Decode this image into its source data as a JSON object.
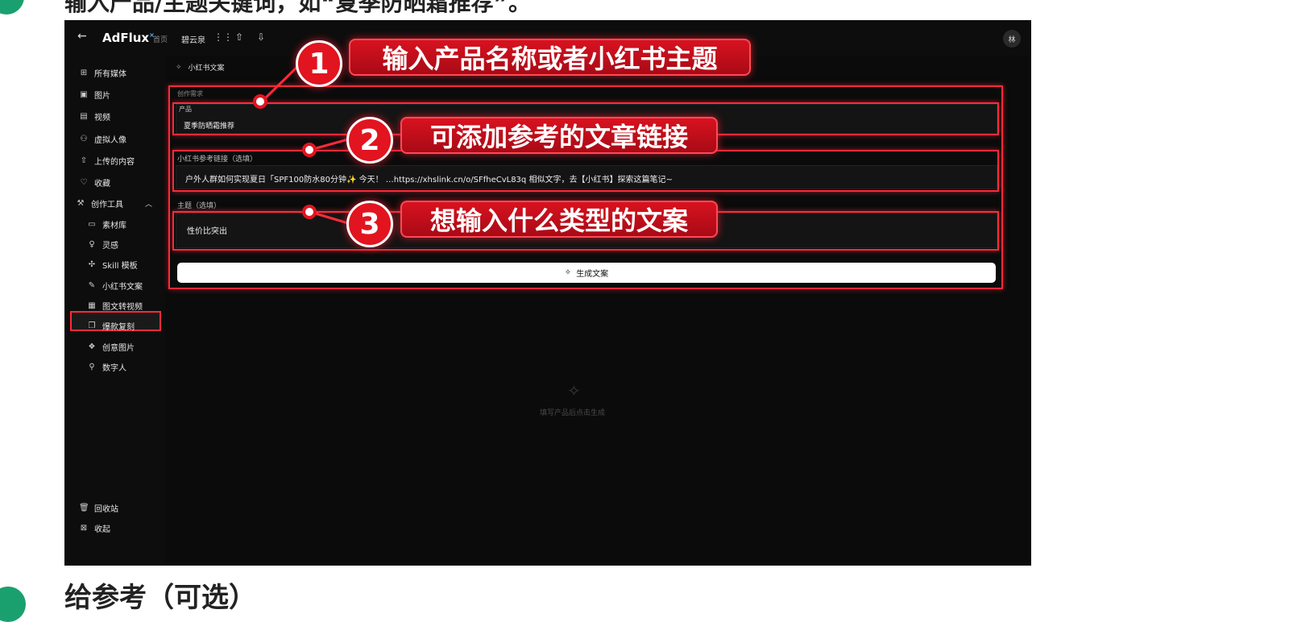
{
  "doc": {
    "top_text": "输入产品/主题关键词，如“夏季防晒霜推荐”。",
    "bottom_text": "给参考（可选）"
  },
  "app": {
    "logo": "AdFlux",
    "logo_mark": "×",
    "nav_home": "首页",
    "nav_workspace": "碧云泉",
    "avatar_text": "林"
  },
  "sidebar": {
    "items": [
      {
        "label": "所有媒体",
        "icon": "grid-icon"
      },
      {
        "label": "图片",
        "icon": "image-icon"
      },
      {
        "label": "视频",
        "icon": "film-icon"
      },
      {
        "label": "虚拟人像",
        "icon": "person-icon"
      },
      {
        "label": "上传的内容",
        "icon": "upload-icon"
      },
      {
        "label": "收藏",
        "icon": "heart-icon"
      },
      {
        "label": "创作工具",
        "icon": "wrench-icon"
      }
    ],
    "tools": [
      {
        "label": "素材库",
        "icon": "folder-icon"
      },
      {
        "label": "灵感",
        "icon": "bulb-icon"
      },
      {
        "label": "Skill 模板",
        "icon": "sparkle-icon"
      },
      {
        "label": "小红书文案",
        "icon": "pen-icon"
      },
      {
        "label": "图文转视频",
        "icon": "gallery-icon"
      },
      {
        "label": "爆款复刻",
        "icon": "copy-icon"
      },
      {
        "label": "创意图片",
        "icon": "palette-icon"
      },
      {
        "label": "数字人",
        "icon": "user-icon"
      }
    ],
    "bottom": [
      {
        "label": "回收站",
        "icon": "trash-icon"
      },
      {
        "label": "收起",
        "icon": "collapse-icon"
      }
    ]
  },
  "main": {
    "page_title": "小红书文案",
    "section_label": "创作需求",
    "product": {
      "label": "产品",
      "value": "夏季防晒霜推荐"
    },
    "reference": {
      "label": "小红书参考链接（选填）",
      "value": "户外人群如何实现夏日「SPF100防水80分钟✨  今天！ …https://xhslink.cn/o/SFfheCvL83q 相似文字，去【小红书】探索这篇笔记~"
    },
    "theme": {
      "label": "主题（选填）",
      "value": "性价比突出"
    },
    "generate_button": "生成文案",
    "empty_hint": "填写产品后点击生成"
  },
  "callouts": [
    {
      "number": "1",
      "text": "输入产品名称或者小红书主题"
    },
    {
      "number": "2",
      "text": "可添加参考的文章链接"
    },
    {
      "number": "3",
      "text": "想输入什么类型的文案"
    }
  ],
  "colors": {
    "highlight": "#ff2a3a",
    "callout_fill": "#d8121f",
    "doc_accent": "#1aa06f"
  }
}
